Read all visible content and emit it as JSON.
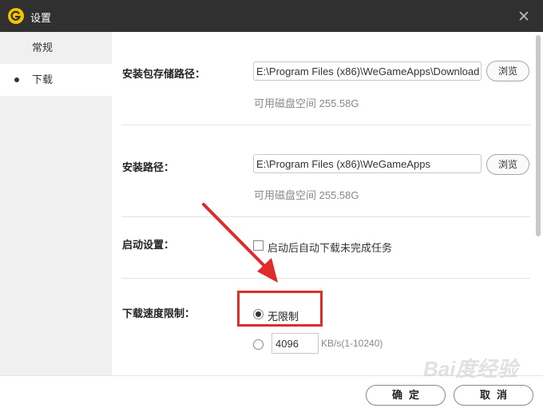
{
  "window": {
    "title": "设置",
    "close_icon": "close-icon",
    "logo_letter": "G"
  },
  "sidebar": {
    "items": [
      {
        "label": "常规",
        "active": false
      },
      {
        "label": "下载",
        "active": true
      }
    ]
  },
  "settings": {
    "install_package_path": {
      "label": "安装包存储路径：",
      "value": "E:\\Program Files (x86)\\WeGameApps\\Download",
      "browse_label": "浏览",
      "disk_space": "可用磁盘空间 255.58G"
    },
    "install_path": {
      "label": "安装路径：",
      "value": "E:\\Program Files (x86)\\WeGameApps",
      "browse_label": "浏览",
      "disk_space": "可用磁盘空间 255.58G"
    },
    "startup": {
      "label": "启动设置：",
      "checkbox_label": "启动后自动下载未完成任务",
      "checked": false
    },
    "speed_limit": {
      "label": "下载速度限制：",
      "unlimited_label": "无限制",
      "unlimited_selected": true,
      "limit_value": "4096",
      "limit_unit": "KB/s(1-10240)"
    }
  },
  "footer": {
    "ok_label": "确定",
    "cancel_label": "取消"
  },
  "annotation": {
    "highlight_color": "#e02b2b",
    "arrow_color": "#e02b2b"
  },
  "watermark": {
    "text": "Bai度经验"
  },
  "colors": {
    "titlebar": "#303030",
    "logo": "#f5c400",
    "sidebar": "#f0f0f0"
  }
}
